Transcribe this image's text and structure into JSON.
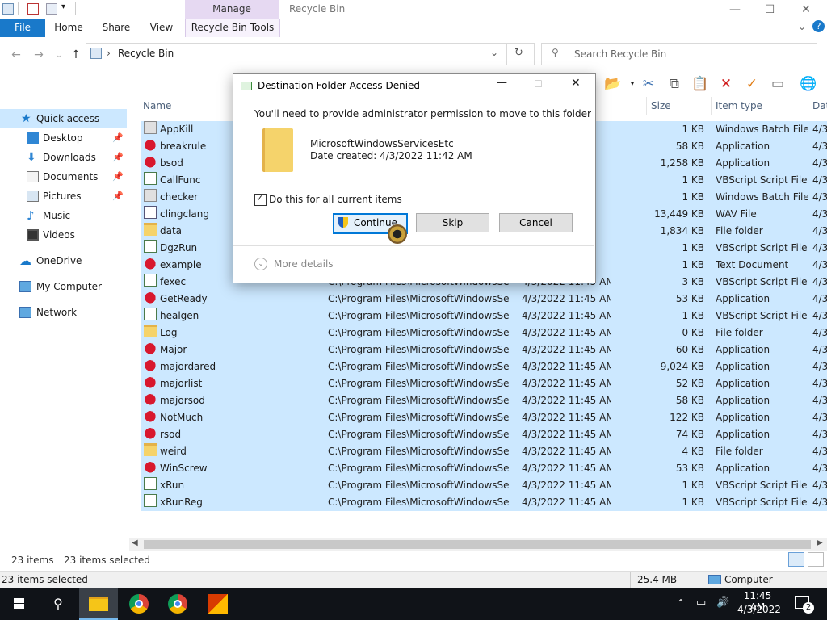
{
  "window": {
    "title": "Recycle Bin",
    "contextual_group": "Manage",
    "controls": {
      "minimize": "—",
      "maximize": "☐",
      "close": "✕"
    }
  },
  "ribbon": {
    "tabs": [
      "File",
      "Home",
      "Share",
      "View",
      "Recycle Bin Tools"
    ],
    "help_icon": "?",
    "collapse_icon": "⌄"
  },
  "nav": {
    "address": "Recycle Bin",
    "search_placeholder": "Search Recycle Bin"
  },
  "sidebar": {
    "items": [
      {
        "label": "Quick access",
        "icon": "star-icon",
        "pinned": false
      },
      {
        "label": "Desktop",
        "icon": "desktop-icon",
        "pinned": true
      },
      {
        "label": "Downloads",
        "icon": "download-icon",
        "pinned": true
      },
      {
        "label": "Documents",
        "icon": "document-icon",
        "pinned": true
      },
      {
        "label": "Pictures",
        "icon": "picture-icon",
        "pinned": true
      },
      {
        "label": "Music",
        "icon": "music-icon",
        "pinned": false
      },
      {
        "label": "Videos",
        "icon": "video-icon",
        "pinned": false
      },
      {
        "label": "OneDrive",
        "icon": "cloud-icon",
        "pinned": false
      },
      {
        "label": "My Computer",
        "icon": "computer-icon",
        "pinned": false
      },
      {
        "label": "Network",
        "icon": "network-icon",
        "pinned": false
      }
    ]
  },
  "columns": {
    "name": "Name",
    "size": "Size",
    "type": "Item type",
    "date2": "Dat"
  },
  "files": [
    {
      "name": "AppKill",
      "kind": "batch",
      "location": "",
      "date": "",
      "size": "1 KB",
      "type": "Windows Batch File",
      "dt": "4/3"
    },
    {
      "name": "breakrule",
      "kind": "app",
      "location": "",
      "date": "",
      "size": "58 KB",
      "type": "Application",
      "dt": "4/3"
    },
    {
      "name": "bsod",
      "kind": "app",
      "location": "",
      "date": "",
      "size": "1,258 KB",
      "type": "Application",
      "dt": "4/3"
    },
    {
      "name": "CallFunc",
      "kind": "vbs",
      "location": "",
      "date": "",
      "size": "1 KB",
      "type": "VBScript Script File",
      "dt": "4/3"
    },
    {
      "name": "checker",
      "kind": "batch",
      "location": "",
      "date": "",
      "size": "1 KB",
      "type": "Windows Batch File",
      "dt": "4/3"
    },
    {
      "name": "clingclang",
      "kind": "wav",
      "location": "",
      "date": "",
      "size": "13,449 KB",
      "type": "WAV File",
      "dt": "4/3"
    },
    {
      "name": "data",
      "kind": "folder",
      "location": "",
      "date": "",
      "size": "1,834 KB",
      "type": "File folder",
      "dt": "4/3"
    },
    {
      "name": "DgzRun",
      "kind": "vbs",
      "location": "",
      "date": "",
      "size": "1 KB",
      "type": "VBScript Script File",
      "dt": "4/3"
    },
    {
      "name": "example",
      "kind": "app",
      "location": "",
      "date": "",
      "size": "1 KB",
      "type": "Text Document",
      "dt": "4/3"
    },
    {
      "name": "fexec",
      "kind": "vbs",
      "location": "C:\\Program Files\\MicrosoftWindowsServ...",
      "date": "4/3/2022 11:45 AM",
      "size": "3 KB",
      "type": "VBScript Script File",
      "dt": "4/3"
    },
    {
      "name": "GetReady",
      "kind": "app",
      "location": "C:\\Program Files\\MicrosoftWindowsServ...",
      "date": "4/3/2022 11:45 AM",
      "size": "53 KB",
      "type": "Application",
      "dt": "4/3"
    },
    {
      "name": "healgen",
      "kind": "vbs",
      "location": "C:\\Program Files\\MicrosoftWindowsServ...",
      "date": "4/3/2022 11:45 AM",
      "size": "1 KB",
      "type": "VBScript Script File",
      "dt": "4/3"
    },
    {
      "name": "Log",
      "kind": "folder",
      "location": "C:\\Program Files\\MicrosoftWindowsServ...",
      "date": "4/3/2022 11:45 AM",
      "size": "0 KB",
      "type": "File folder",
      "dt": "4/3"
    },
    {
      "name": "Major",
      "kind": "app",
      "location": "C:\\Program Files\\MicrosoftWindowsServ...",
      "date": "4/3/2022 11:45 AM",
      "size": "60 KB",
      "type": "Application",
      "dt": "4/3"
    },
    {
      "name": "majordared",
      "kind": "app",
      "location": "C:\\Program Files\\MicrosoftWindowsServ...",
      "date": "4/3/2022 11:45 AM",
      "size": "9,024 KB",
      "type": "Application",
      "dt": "4/3"
    },
    {
      "name": "majorlist",
      "kind": "app",
      "location": "C:\\Program Files\\MicrosoftWindowsServ...",
      "date": "4/3/2022 11:45 AM",
      "size": "52 KB",
      "type": "Application",
      "dt": "4/3"
    },
    {
      "name": "majorsod",
      "kind": "app",
      "location": "C:\\Program Files\\MicrosoftWindowsServ...",
      "date": "4/3/2022 11:45 AM",
      "size": "58 KB",
      "type": "Application",
      "dt": "4/3"
    },
    {
      "name": "NotMuch",
      "kind": "app",
      "location": "C:\\Program Files\\MicrosoftWindowsServ...",
      "date": "4/3/2022 11:45 AM",
      "size": "122 KB",
      "type": "Application",
      "dt": "4/3"
    },
    {
      "name": "rsod",
      "kind": "app",
      "location": "C:\\Program Files\\MicrosoftWindowsServ...",
      "date": "4/3/2022 11:45 AM",
      "size": "74 KB",
      "type": "Application",
      "dt": "4/3"
    },
    {
      "name": "weird",
      "kind": "folder",
      "location": "C:\\Program Files\\MicrosoftWindowsServ...",
      "date": "4/3/2022 11:45 AM",
      "size": "4 KB",
      "type": "File folder",
      "dt": "4/3"
    },
    {
      "name": "WinScrew",
      "kind": "app",
      "location": "C:\\Program Files\\MicrosoftWindowsServ...",
      "date": "4/3/2022 11:45 AM",
      "size": "53 KB",
      "type": "Application",
      "dt": "4/3"
    },
    {
      "name": "xRun",
      "kind": "vbs",
      "location": "C:\\Program Files\\MicrosoftWindowsServ...",
      "date": "4/3/2022 11:45 AM",
      "size": "1 KB",
      "type": "VBScript Script File",
      "dt": "4/3"
    },
    {
      "name": "xRunReg",
      "kind": "vbs",
      "location": "C:\\Program Files\\MicrosoftWindowsServ...",
      "date": "4/3/2022 11:45 AM",
      "size": "1 KB",
      "type": "VBScript Script File",
      "dt": "4/3"
    }
  ],
  "status": {
    "item_count": "23 items",
    "selected": "23 items selected",
    "bottom_selected": "23 items selected",
    "size": "25.4 MB",
    "computer": "Computer"
  },
  "dialog": {
    "title": "Destination Folder Access Denied",
    "message": "You'll need to provide administrator permission to move to this folder",
    "folder_name": "MicrosoftWindowsServicesEtc",
    "date_created": "Date created: 4/3/2022 11:42 AM",
    "checkbox_label": "Do this for all current items",
    "checkbox_checked": true,
    "continue_label": "Continue",
    "skip_label": "Skip",
    "cancel_label": "Cancel",
    "more_details": "More details"
  },
  "taskbar": {
    "time": "11:45 AM",
    "date": "4/3/2022",
    "notification_count": "2"
  },
  "colors": {
    "selection": "#cce8ff",
    "accent": "#1979ca",
    "manage_tab": "#e6d9f2",
    "taskbar": "#101318"
  }
}
